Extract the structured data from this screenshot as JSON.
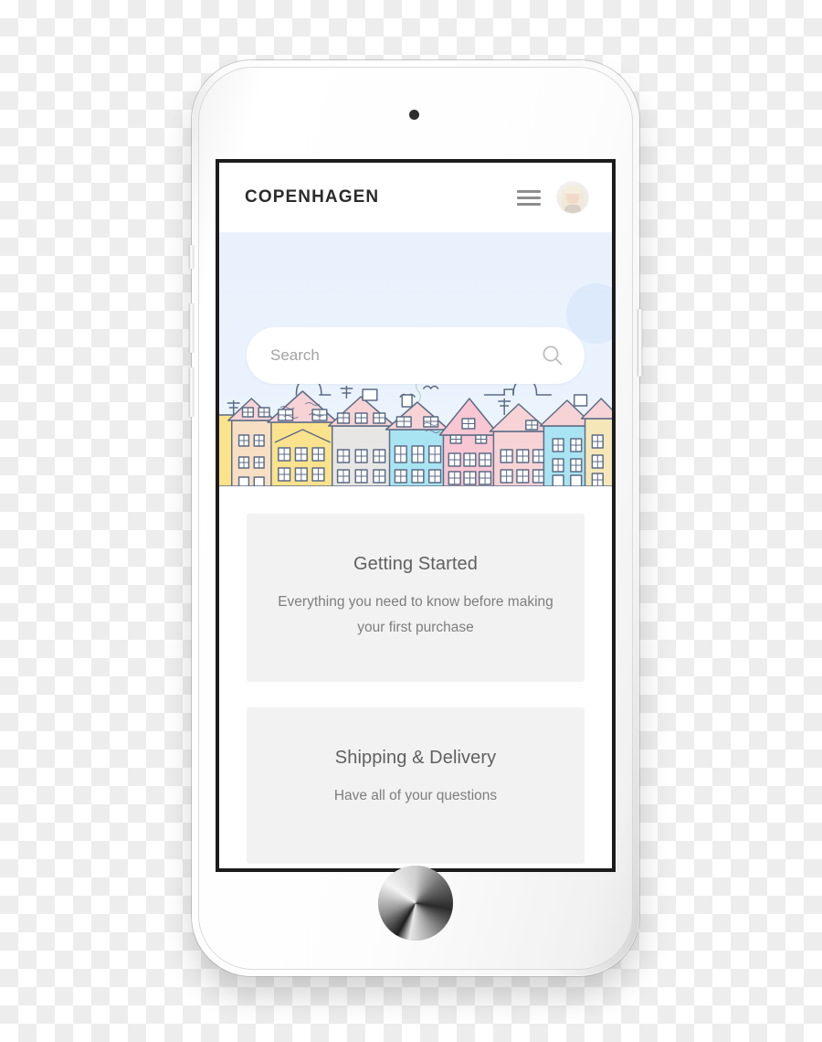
{
  "device": {
    "type": "white-smartphone",
    "hardware": {
      "front_camera": "front-camera",
      "proximity_sensor": "proximity-sensor",
      "earpiece_speaker": "earpiece-speaker",
      "home_button": "home-button",
      "mute_switch": "mute-switch",
      "volume_up": "volume-up-button",
      "volume_down": "volume-down-button",
      "power_button": "power-button"
    }
  },
  "app": {
    "header": {
      "brand": "COPENHAGEN",
      "menu_icon": "hamburger-menu-icon",
      "avatar_icon": "user-avatar"
    },
    "hero": {
      "illustration": "copenhagen-nyhavn-skyline",
      "sky_color": "#eaf3fd",
      "sun_color": "#d9e8fa",
      "line_color": "#5b6b85",
      "building_colors": [
        "#fbe28c",
        "#f7dfc4",
        "#f7d3d6",
        "#e8e6e4",
        "#a9e4f2",
        "#f9c6d3",
        "#f6e7b8"
      ],
      "search": {
        "placeholder": "Search",
        "value": "",
        "icon": "search-icon"
      }
    },
    "cards": [
      {
        "id": "getting-started",
        "title": "Getting Started",
        "description": "Everything you need to know before making your first purchase"
      },
      {
        "id": "shipping-delivery",
        "title": "Shipping & Delivery",
        "description": "Have all of your questions"
      }
    ]
  },
  "colors": {
    "card_background": "#f2f2f2",
    "card_title": "#606060",
    "card_text": "#7e7e7e",
    "brand_text": "#2b2b2b",
    "menu_icon": "#8d8d8d",
    "placeholder": "#a2a2a2",
    "screen_border": "#1c1c1c"
  }
}
